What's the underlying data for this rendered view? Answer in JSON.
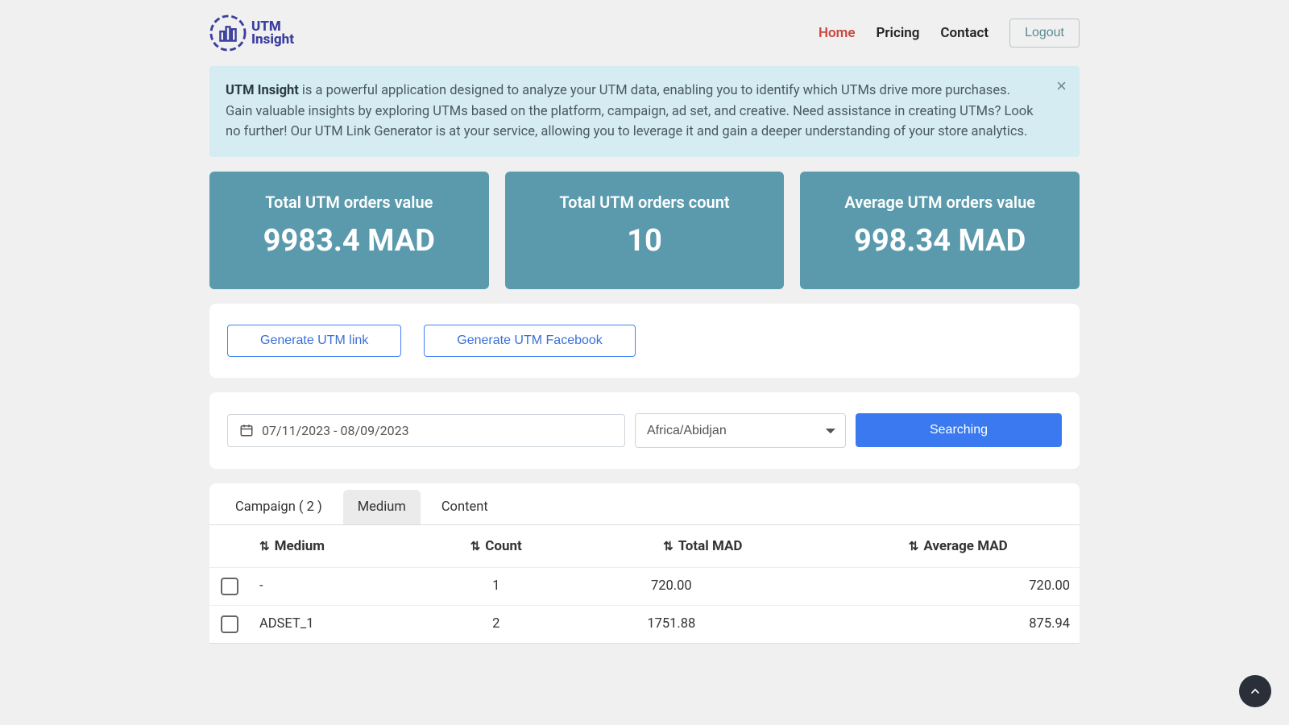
{
  "logo": {
    "line1": "UTM",
    "line2": "Insight"
  },
  "nav": {
    "home": "Home",
    "pricing": "Pricing",
    "contact": "Contact",
    "logout": "Logout"
  },
  "banner": {
    "strong": "UTM Insight",
    "text": " is a powerful application designed to analyze your UTM data, enabling you to identify which UTMs drive more purchases. Gain valuable insights by exploring UTMs based on the platform, campaign, ad set, and creative. Need assistance in creating UTMs? Look no further! Our UTM Link Generator is at your service, allowing you to leverage it and gain a deeper understanding of your store analytics."
  },
  "cards": [
    {
      "title": "Total UTM orders value",
      "value": "9983.4 MAD"
    },
    {
      "title": "Total UTM orders count",
      "value": "10"
    },
    {
      "title": "Average UTM orders value",
      "value": "998.34 MAD"
    }
  ],
  "gen": {
    "link": "Generate UTM link",
    "fb": "Generate UTM Facebook"
  },
  "search": {
    "date": "07/11/2023 - 08/09/2023",
    "tz": "Africa/Abidjan",
    "btn": "Searching"
  },
  "tabs": {
    "campaign": "Campaign ( 2 )",
    "medium": "Medium",
    "content": "Content"
  },
  "table": {
    "headers": {
      "medium": "Medium",
      "count": "Count",
      "total": "Total MAD",
      "average": "Average MAD"
    },
    "rows": [
      {
        "medium": "-",
        "count": "1",
        "total": "720.00",
        "average": "720.00"
      },
      {
        "medium": "ADSET_1",
        "count": "2",
        "total": "1751.88",
        "average": "875.94"
      }
    ]
  }
}
